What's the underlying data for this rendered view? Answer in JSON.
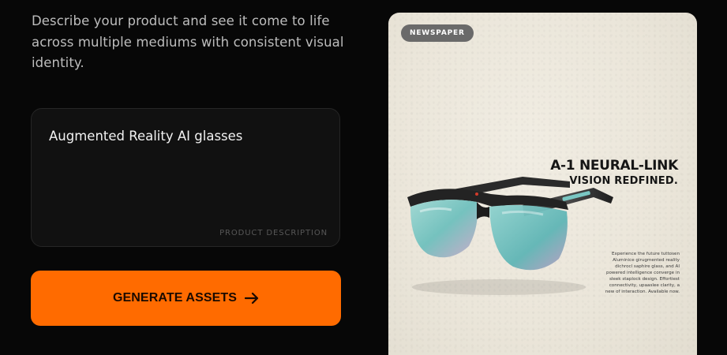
{
  "intro_text": "Describe your product and see it come to life across multiple mediums with consistent visual identity.",
  "description": {
    "value": "Augmented Reality AI glasses",
    "label": "PRODUCT DESCRIPTION"
  },
  "generate_button": {
    "label": "GENERATE ASSETS",
    "icon": "arrow-right-icon"
  },
  "preview": {
    "badge": "NEWSPAPER",
    "headline": "A-1 NEURAL-LINK",
    "subheadline": "VISION REDFINED.",
    "blurb": "Experience the future tuttosen Aluminice girugmented reality dichrocl saphire glass, and AI powered intelligence converge in sleek staplock design. Effortiest connectivity, upaaslee clarity, a new of interaction. Available now.",
    "image": "sunglasses-product-image"
  },
  "colors": {
    "background": "#070707",
    "accent": "#ff6b00",
    "card": "#ece8dd",
    "lens": "#79c6c2"
  }
}
